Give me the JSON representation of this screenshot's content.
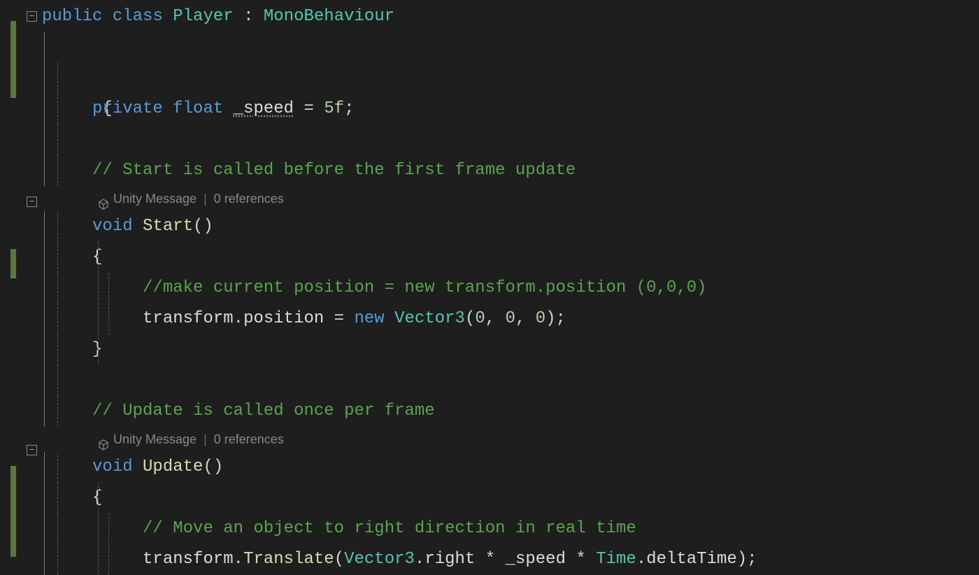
{
  "code": {
    "line1": {
      "kw_public": "public",
      "kw_class": "class",
      "classname": "Player",
      "colon": " : ",
      "basetype": "MonoBehaviour"
    },
    "line2": {
      "brace": "{"
    },
    "line3": {
      "kw_private": "private",
      "kw_float": "float",
      "field": "_speed",
      "eq": " = ",
      "val": "5f",
      "semi": ";"
    },
    "line5": {
      "comment": "// Start is called before the first frame update"
    },
    "codelens1": {
      "unity": "Unity Message",
      "refs": "0 references"
    },
    "line6": {
      "kw_void": "void",
      "method": "Start",
      "parens": "()"
    },
    "line7": {
      "brace": "{"
    },
    "line8": {
      "comment": "//make current position = new transform.position (0,0,0)"
    },
    "line9": {
      "obj": "transform",
      "dot1": ".",
      "prop": "position",
      "eq": " = ",
      "kw_new": "new",
      "type": "Vector3",
      "args_open": "(",
      "n0a": "0",
      "c1": ", ",
      "n0b": "0",
      "c2": ", ",
      "n0c": "0",
      "args_close": ")",
      "semi": ";"
    },
    "line10": {
      "brace": "}"
    },
    "line12": {
      "comment": "// Update is called once per frame"
    },
    "codelens2": {
      "unity": "Unity Message",
      "refs": "0 references"
    },
    "line13": {
      "kw_void": "void",
      "method": "Update",
      "parens": "()"
    },
    "line14": {
      "brace": "{"
    },
    "line15": {
      "comment": "// Move an object to right direction in real time"
    },
    "line16": {
      "obj": "transform",
      "dot1": ".",
      "method": "Translate",
      "open": "(",
      "type": "Vector3",
      "dot2": ".",
      "prop": "right",
      "mul1": " * ",
      "field": "_speed",
      "mul2": " * ",
      "type2": "Time",
      "dot3": ".",
      "prop2": "deltaTime",
      "close": ")",
      "semi": ";"
    }
  }
}
